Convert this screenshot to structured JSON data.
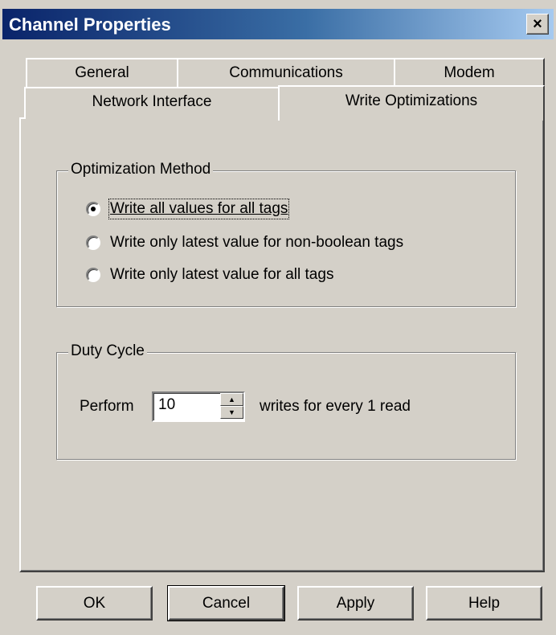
{
  "window": {
    "title": "Channel Properties",
    "close_label": "×"
  },
  "tabs": {
    "row1": [
      "General",
      "Communications",
      "Modem"
    ],
    "row2": [
      "Network Interface",
      "Write Optimizations"
    ],
    "active": "Write Optimizations"
  },
  "optimization": {
    "label": "Optimization Method",
    "options": [
      {
        "label": "Write all values for all tags",
        "checked": true
      },
      {
        "label": "Write only latest value for non-boolean tags",
        "checked": false
      },
      {
        "label": "Write only latest value for all tags",
        "checked": false
      }
    ]
  },
  "duty_cycle": {
    "label": "Duty Cycle",
    "prefix": "Perform",
    "value": "10",
    "suffix": "writes for every 1 read"
  },
  "buttons": {
    "ok": "OK",
    "cancel": "Cancel",
    "apply": "Apply",
    "help": "Help"
  }
}
